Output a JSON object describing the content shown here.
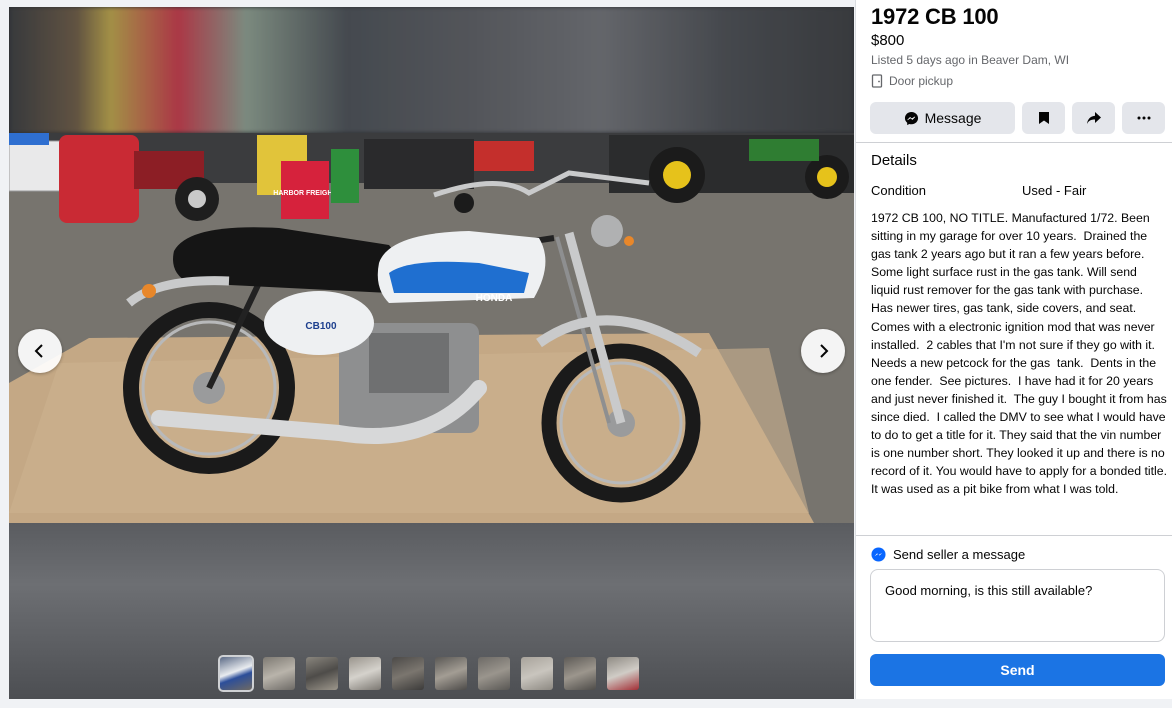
{
  "listing": {
    "title": "1972 CB 100",
    "price": "$800",
    "listed": "Listed 5 days ago in Beaver Dam, WI",
    "pickup": "Door pickup"
  },
  "actions": {
    "message_label": "Message"
  },
  "details": {
    "heading": "Details",
    "condition_label": "Condition",
    "condition_value": "Used - Fair",
    "description": "1972 CB 100, NO TITLE. Manufactured 1/72. Been sitting in my garage for over 10 years.  Drained the gas tank 2 years ago but it ran a few years before.  Some light surface rust in the gas tank. Will send liquid rust remover for the gas tank with purchase.  Has newer tires, gas tank, side covers, and seat.  Comes with a electronic ignition mod that was never installed.  2 cables that I'm not sure if they go with it.  Needs a new petcock for the gas  tank.  Dents in the one fender.  See pictures.  I have had it for 20 years and just never finished it.  The guy I bought it from has since died.  I called the DMV to see what I would have to do to get a title for it. They said that the vin number is one number short. They looked it up and there is no record of it. You would have to apply for a bonded title.  It was used as a pit bike from what I was told."
  },
  "seller_message": {
    "heading": "Send seller a message",
    "text": "Good morning, is this still available?",
    "send_label": "Send"
  },
  "photo": {
    "tank_badge": "HONDA",
    "side_badge": "CB100",
    "bucket_label": "HARBOR FREIGHT"
  },
  "thumbnails_count": 10,
  "colors": {
    "accent": "#1b74e4",
    "messenger": "#0866ff",
    "button_bg": "#e4e6eb",
    "secondary_text": "#65676b"
  }
}
